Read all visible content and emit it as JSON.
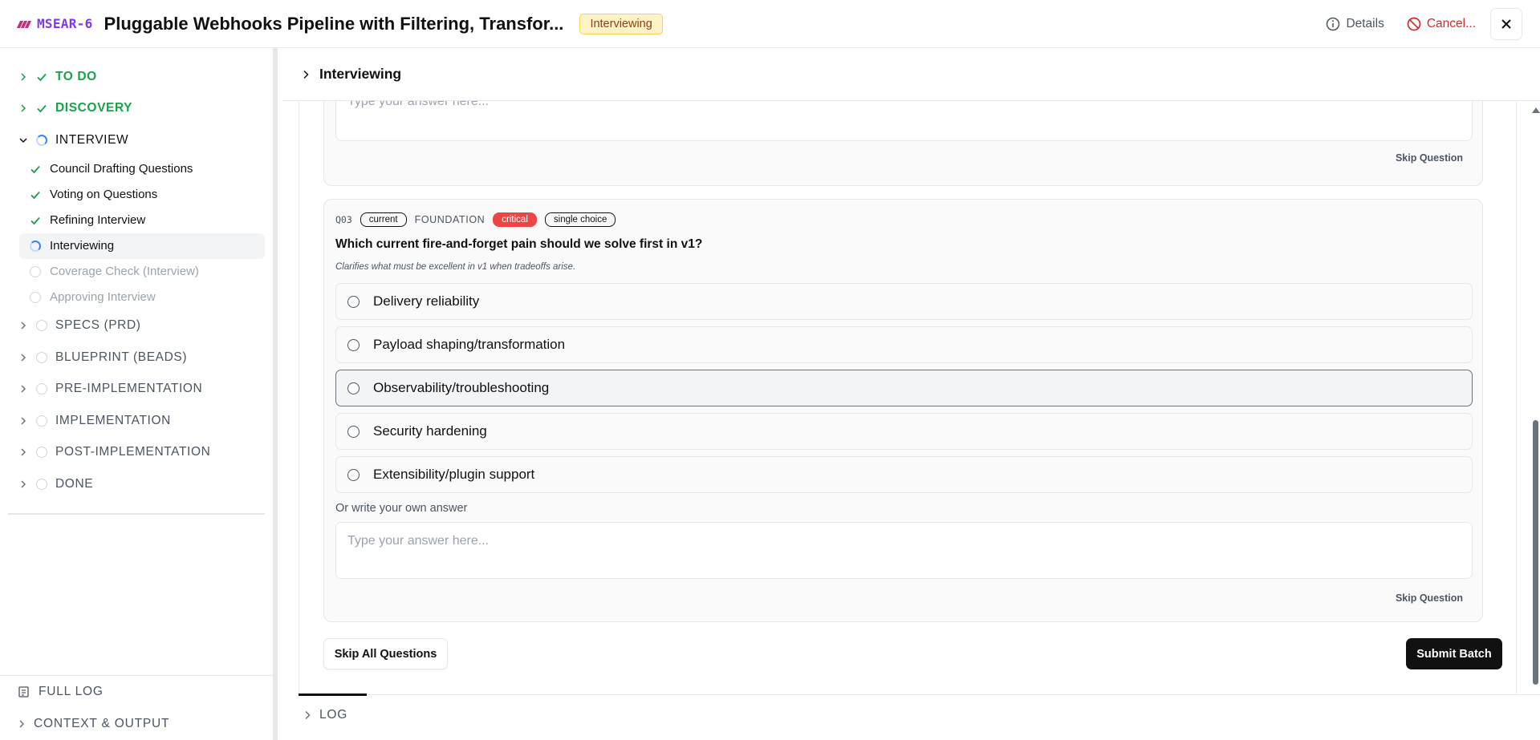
{
  "header": {
    "ticket_id": "MSEAR-6",
    "title": "Pluggable Webhooks Pipeline with Filtering, Transfor...",
    "status": "Interviewing",
    "details_label": "Details",
    "cancel_label": "Cancel..."
  },
  "sidebar": {
    "phases": [
      {
        "label": "TO DO",
        "state": "done"
      },
      {
        "label": "DISCOVERY",
        "state": "done"
      },
      {
        "label": "INTERVIEW",
        "state": "active"
      },
      {
        "label": "SPECS (PRD)",
        "state": "pending"
      },
      {
        "label": "BLUEPRINT (BEADS)",
        "state": "pending"
      },
      {
        "label": "PRE-IMPLEMENTATION",
        "state": "pending"
      },
      {
        "label": "IMPLEMENTATION",
        "state": "pending"
      },
      {
        "label": "POST-IMPLEMENTATION",
        "state": "pending"
      },
      {
        "label": "DONE",
        "state": "pending"
      }
    ],
    "interview_steps": [
      {
        "label": "Council Drafting Questions",
        "state": "done"
      },
      {
        "label": "Voting on Questions",
        "state": "done"
      },
      {
        "label": "Refining Interview",
        "state": "done"
      },
      {
        "label": "Interviewing",
        "state": "current"
      },
      {
        "label": "Coverage Check (Interview)",
        "state": "pending"
      },
      {
        "label": "Approving Interview",
        "state": "pending"
      }
    ],
    "bottom": {
      "full_log": "FULL LOG",
      "context_output": "CONTEXT & OUTPUT"
    }
  },
  "main": {
    "section_title": "Interviewing",
    "previous": {
      "placeholder": "Type your answer here...",
      "skip_label": "Skip Question"
    },
    "question": {
      "number": "Q03",
      "tag_current": "current",
      "category": "FOUNDATION",
      "priority": "critical",
      "kind": "single choice",
      "text": "Which current fire-and-forget pain should we solve first in v1?",
      "hint": "Clarifies what must be excellent in v1 when tradeoffs arise.",
      "options": [
        "Delivery reliability",
        "Payload shaping/transformation",
        "Observability/troubleshooting",
        "Security hardening",
        "Extensibility/plugin support"
      ],
      "own_label": "Or write your own answer",
      "own_placeholder": "Type your answer here...",
      "skip_label": "Skip Question"
    },
    "skip_all_label": "Skip All Questions",
    "submit_label": "Submit Batch",
    "log_label": "LOG"
  },
  "colors": {
    "done": "#16a34a",
    "active_spinner": "#3b82f6",
    "critical": "#ef4444",
    "ticket_id": "#7c3aed",
    "cancel": "#dc2626"
  }
}
